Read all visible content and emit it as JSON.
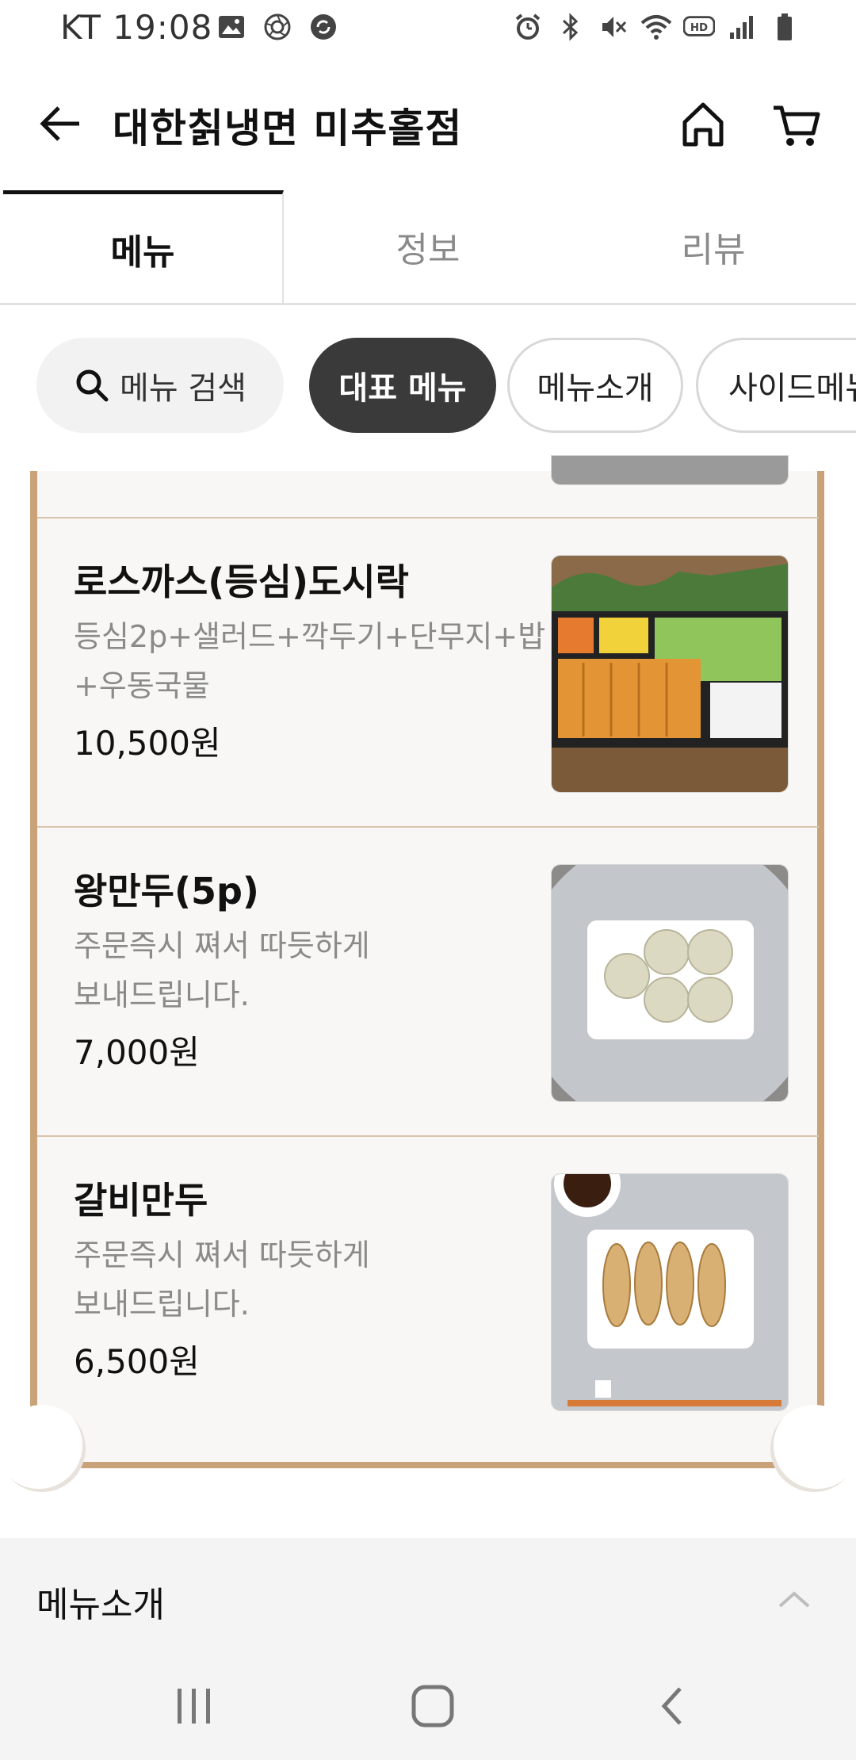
{
  "status_bar": {
    "carrier_time": "KT 19:08",
    "left_icons": [
      "gallery-icon",
      "aperture-icon",
      "sync-icon"
    ],
    "right_icons": [
      "alarm-icon",
      "bluetooth-icon",
      "mute-icon",
      "wifi-icon",
      "hd-icon",
      "signal-icon",
      "battery-icon"
    ]
  },
  "app_bar": {
    "title": "대한칡냉면 미추홀점",
    "back_icon": "arrow-left-icon",
    "home_icon": "home-icon",
    "cart_icon": "cart-icon"
  },
  "tabs": [
    {
      "label": "메뉴",
      "active": true
    },
    {
      "label": "정보",
      "active": false
    },
    {
      "label": "리뷰",
      "active": false
    }
  ],
  "chips": {
    "search": "메뉴 검색",
    "items": [
      "대표 메뉴",
      "메뉴소개",
      "사이드메뉴"
    ]
  },
  "menu_items": [
    {
      "name": "로스까스(등심)도시락",
      "desc_line1": "등심2p+샐러드+깍두기+단무지+밥",
      "desc_line2": "+우동국물",
      "price": "10,500원"
    },
    {
      "name": "왕만두(5p)",
      "desc_line1": "주문즉시 쪄서 따듯하게",
      "desc_line2": "보내드립니다.",
      "price": "7,000원"
    },
    {
      "name": "갈비만두",
      "desc_line1": "주문즉시 쪄서 따듯하게",
      "desc_line2": "보내드립니다.",
      "price": "6,500원"
    }
  ],
  "section": {
    "label": "메뉴소개",
    "icon": "chevron-up-icon"
  },
  "nav_bar": {
    "icons": [
      "recents-icon",
      "home-circle-icon",
      "back-chevron-icon"
    ]
  },
  "colors": {
    "accent_border": "#c9a27a",
    "chip_active_bg": "#3a3a3a",
    "card_bg": "#f8f7f5"
  }
}
